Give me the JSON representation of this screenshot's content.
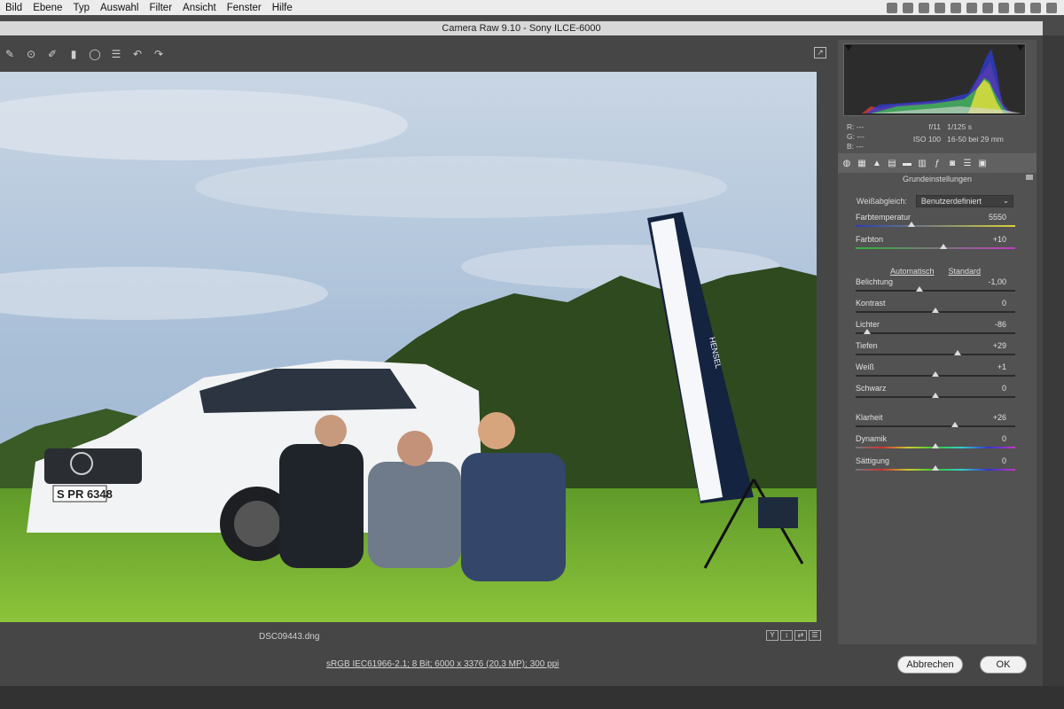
{
  "menubar": {
    "items": [
      "Bild",
      "Ebene",
      "Typ",
      "Auswahl",
      "Filter",
      "Ansicht",
      "Fenster",
      "Hilfe"
    ]
  },
  "dialog": {
    "title": "Camera Raw 9.10  -  Sony ILCE-6000"
  },
  "image": {
    "filename": "DSC09443.dng"
  },
  "workflow": "sRGB IEC61966-2.1; 8 Bit; 6000 x 3376 (20,3 MP); 300 ppi",
  "buttons": {
    "cancel": "Abbrechen",
    "ok": "OK"
  },
  "readout": {
    "r": "R:   ---",
    "g": "G:   ---",
    "b": "B:   ---",
    "aperture": "f/11",
    "shutter": "1/125 s",
    "iso": "ISO 100",
    "lens": "16-50 bei 29 mm"
  },
  "panel": {
    "title": "Grundeinstellungen",
    "wb_label": "Weißabgleich:",
    "wb_value": "Benutzerdefiniert",
    "auto": "Automatisch",
    "standard": "Standard",
    "sliders": [
      {
        "label": "Farbtemperatur",
        "value": "5550",
        "pos": 0.35,
        "track": "linear-gradient(90deg,#2a3fb5,#d9d23a)"
      },
      {
        "label": "Farbton",
        "value": "+10",
        "pos": 0.55,
        "track": "linear-gradient(90deg,#2fb43a,#c23bbf)"
      },
      {
        "label": "Belichtung",
        "value": "-1,00",
        "pos": 0.4,
        "track": "#2b2b2b"
      },
      {
        "label": "Kontrast",
        "value": "0",
        "pos": 0.5,
        "track": "#2b2b2b"
      },
      {
        "label": "Lichter",
        "value": "-86",
        "pos": 0.07,
        "track": "#2b2b2b"
      },
      {
        "label": "Tiefen",
        "value": "+29",
        "pos": 0.64,
        "track": "#2b2b2b"
      },
      {
        "label": "Weiß",
        "value": "+1",
        "pos": 0.5,
        "track": "#2b2b2b"
      },
      {
        "label": "Schwarz",
        "value": "0",
        "pos": 0.5,
        "track": "#2b2b2b"
      },
      {
        "label": "Klarheit",
        "value": "+26",
        "pos": 0.62,
        "track": "#2b2b2b"
      },
      {
        "label": "Dynamik",
        "value": "0",
        "pos": 0.5,
        "track": "linear-gradient(90deg,#777,#c33,#cc3,#3c3,#3cc,#33c,#c3c)"
      },
      {
        "label": "Sättigung",
        "value": "0",
        "pos": 0.5,
        "track": "linear-gradient(90deg,#777,#c33,#cc3,#3c3,#3cc,#33c,#c3c)"
      }
    ]
  },
  "photo": {
    "license_plate": "S PR 6348",
    "softbox_brand": "HENSEL"
  }
}
